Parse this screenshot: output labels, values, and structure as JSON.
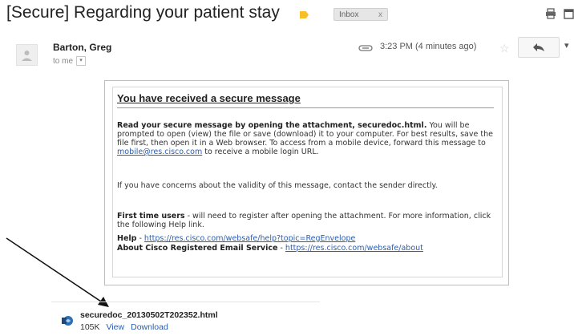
{
  "header": {
    "subject": "[Secure] Regarding your patient stay",
    "label_chip": "Inbox",
    "label_close": "x"
  },
  "sender": {
    "name": "Barton, Greg",
    "to": "to me",
    "time": "3:23 PM (4 minutes ago)",
    "star": "☆",
    "reply_icon": "reply-arrow",
    "more": "▾"
  },
  "message": {
    "title": "You have received a secure message",
    "p1_bold": "Read your secure message by opening the attachment, securedoc.html.",
    "p1_text": " You will be prompted to open (view) the file or save (download) it to your computer. For best results, save the file first, then open it in a Web browser. To access from a mobile device, forward this message to ",
    "p1_link": "mobile@res.cisco.com",
    "p1_tail": " to receive a mobile login URL.",
    "p2": "If you have concerns about the validity of this message, contact the sender directly.",
    "p3_bold": "First time users",
    "p3_text": " - will need to register after opening the attachment. For more information, click the following Help link.",
    "help_label": "Help",
    "help_sep": " - ",
    "help_link": "https://res.cisco.com/websafe/help?topic=RegEnvelope",
    "about_label": "About Cisco Registered Email Service",
    "about_sep": " - ",
    "about_link": "https://res.cisco.com/websafe/about"
  },
  "attachment": {
    "filename": "securedoc_20130502T202352.html",
    "size": "105K",
    "view": "View",
    "download": "Download"
  },
  "colors": {
    "link": "#2a5db0",
    "label_tag": "#f6c026"
  }
}
